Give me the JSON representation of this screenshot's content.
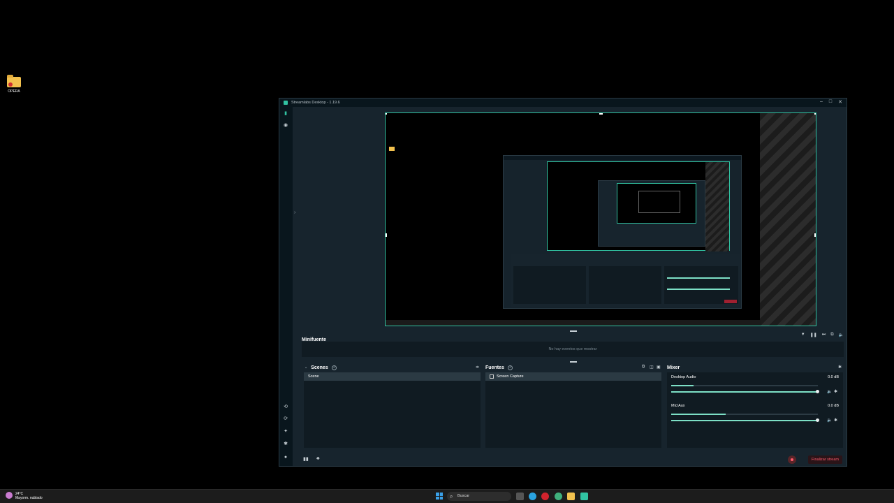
{
  "desktop": {
    "icon_label": "OPERA"
  },
  "window": {
    "title": "Streamlabs Desktop - 1.19.6",
    "controls": {
      "minimize": "–",
      "maximize": "□",
      "close": "✕"
    }
  },
  "minifuente": {
    "title": "Minifuente",
    "empty_text": "No hay eventos que mostrar"
  },
  "scenes": {
    "title": "Scenes",
    "items": [
      "Scene"
    ]
  },
  "sources": {
    "title": "Fuentes",
    "items": [
      "Screen Capture"
    ]
  },
  "mixer": {
    "title": "Mixer",
    "channels": [
      {
        "name": "Desktop Audio",
        "db": "0.0 dB",
        "level": 0.15,
        "volume": 1.0
      },
      {
        "name": "Mic/Aux",
        "db": "0.0 dB",
        "level": 0.37,
        "volume": 1.0
      }
    ]
  },
  "footer": {
    "end_stream_label": "Finalizar stream"
  },
  "taskbar": {
    "weather_temp": "24°C",
    "weather_desc": "Mayorm. nublado",
    "search_placeholder": "Buscar"
  },
  "colors": {
    "accent": "#31c3a2",
    "danger": "#ff5a6c",
    "panel": "#101b22",
    "window": "#17242d"
  }
}
